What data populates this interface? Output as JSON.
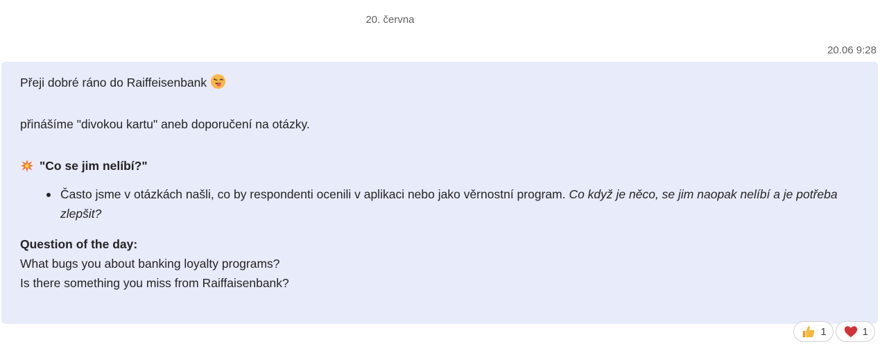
{
  "date_divider": "20. června",
  "message": {
    "timestamp": "20.06 9:28",
    "greeting": "Přeji dobré ráno do Raiffeisenbank",
    "greeting_emoji": "winking-face-with-tongue-icon",
    "intro": "přinášíme \"divokou kartu\" aneb doporučení na otázky.",
    "heading_icon": "collision-icon",
    "heading": "\"Co se jim nelíbí?\"",
    "bullet": {
      "text": "Často jsme v otázkách našli, co by respondenti ocenili v aplikaci nebo jako věrnostní program.",
      "italic": "Co když je něco, se jim naopak nelíbí a je potřeba zlepšit?"
    },
    "question_title": "Question of the day:",
    "question_lines": [
      "What bugs you about banking loyalty programs?",
      "Is there something you miss from Raiffaisenbank?"
    ]
  },
  "reactions": [
    {
      "icon": "thumbs-up-icon",
      "count": "1"
    },
    {
      "icon": "heart-icon",
      "count": "1"
    }
  ],
  "colors": {
    "bubble_bg": "#e8ebfa",
    "heart": "#d13438",
    "thumb": "#f4b942"
  }
}
